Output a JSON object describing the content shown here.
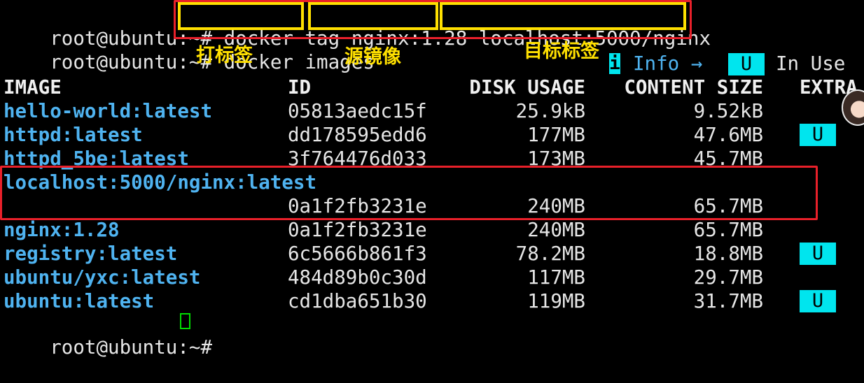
{
  "terminal": {
    "prompt": "root@ubuntu:~# ",
    "command1": {
      "cmd": "docker tag",
      "source": "nginx:1.28",
      "target": "localhost:5000/nginx"
    },
    "command2": "docker images",
    "annotations": {
      "tag_label": "打标签",
      "source_label": "源镜像",
      "target_label": "目标标签"
    },
    "legend": {
      "info_icon": "i",
      "info_text": "Info →",
      "badge": "U",
      "in_use_text": "In Use"
    },
    "table": {
      "headers": [
        "IMAGE",
        "ID",
        "DISK USAGE",
        "CONTENT SIZE",
        "EXTRA"
      ],
      "rows": [
        {
          "image": "hello-world:latest",
          "id": "05813aedc15f",
          "disk": "25.9kB",
          "content": "9.52kB",
          "extra": ""
        },
        {
          "image": "httpd:latest",
          "id": "dd178595edd6",
          "disk": "177MB",
          "content": "47.6MB",
          "extra": "U"
        },
        {
          "image": "httpd_5be:latest",
          "id": "3f764476d033",
          "disk": "173MB",
          "content": "45.7MB",
          "extra": ""
        },
        {
          "image": "localhost:5000/nginx:latest",
          "id": "0a1f2fb3231e",
          "disk": "240MB",
          "content": "65.7MB",
          "extra": ""
        },
        {
          "image": "nginx:1.28",
          "id": "0a1f2fb3231e",
          "disk": "240MB",
          "content": "65.7MB",
          "extra": ""
        },
        {
          "image": "registry:latest",
          "id": "6c5666b861f3",
          "disk": "78.2MB",
          "content": "18.8MB",
          "extra": "U"
        },
        {
          "image": "ubuntu/yxc:latest",
          "id": "484d89b0c30d",
          "disk": "117MB",
          "content": "29.7MB",
          "extra": ""
        },
        {
          "image": "ubuntu:latest",
          "id": "cd1dba651b30",
          "disk": "119MB",
          "content": "31.7MB",
          "extra": "U"
        }
      ]
    }
  },
  "colors": {
    "background": "#000000",
    "image_name": "#4fb3f0",
    "annotation_yellow": "#ffe000",
    "highlight_red": "#e8202a",
    "badge_cyan": "#00e5ee",
    "cursor_green": "#00dd00"
  }
}
